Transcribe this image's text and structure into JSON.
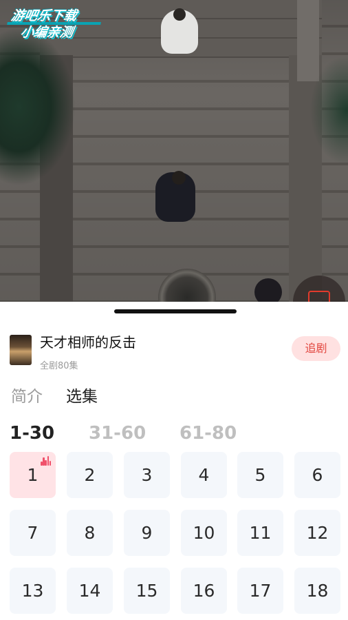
{
  "video": {
    "watermark": {
      "line1": "游吧乐下载",
      "line2": "小编亲测"
    },
    "float_button_icon": "subtitle-icon"
  },
  "drama": {
    "title": "天才相师的反击",
    "episode_count": "全剧80集",
    "follow_label": "追剧"
  },
  "tabs": [
    {
      "label": "简介",
      "active": false
    },
    {
      "label": "选集",
      "active": true
    }
  ],
  "ranges": [
    {
      "label": "1-30",
      "active": true
    },
    {
      "label": "31-60",
      "active": false
    },
    {
      "label": "61-80",
      "active": false
    }
  ],
  "episodes": [
    "1",
    "2",
    "3",
    "4",
    "5",
    "6",
    "7",
    "8",
    "9",
    "10",
    "11",
    "12",
    "13",
    "14",
    "15",
    "16",
    "17",
    "18"
  ],
  "current_episode": "1",
  "colors": {
    "accent": "#e2463f",
    "active_episode_bg": "#ffe3e6",
    "episode_bg": "#f4f7fb",
    "follow_bg": "#ffe1e1"
  }
}
